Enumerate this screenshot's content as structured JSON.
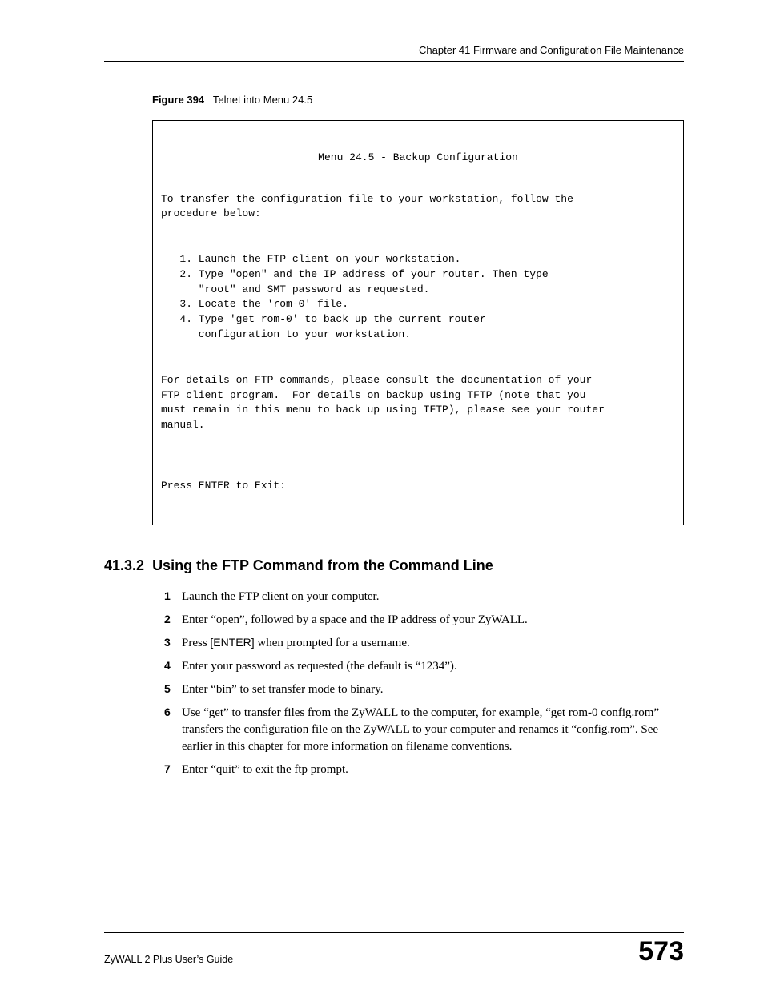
{
  "header": {
    "chapter": "Chapter 41 Firmware and Configuration File Maintenance"
  },
  "figure": {
    "label": "Figure 394",
    "caption": "Telnet into Menu 24.5"
  },
  "telnet": {
    "title": "Menu 24.5 - Backup Configuration",
    "intro": "To transfer the configuration file to your workstation, follow the \nprocedure below:",
    "items": "   1. Launch the FTP client on your workstation.\n   2. Type \"open\" and the IP address of your router. Then type \n      \"root\" and SMT password as requested.\n   3. Locate the 'rom-0' file.\n   4. Type 'get rom-0' to back up the current router \n      configuration to your workstation.",
    "details": "For details on FTP commands, please consult the documentation of your \nFTP client program.  For details on backup using TFTP (note that you \nmust remain in this menu to back up using TFTP), please see your router \nmanual.",
    "press": "Press ENTER to Exit:"
  },
  "section": {
    "number": "41.3.2",
    "title": "Using the FTP Command from the Command Line"
  },
  "steps": {
    "s1": "Launch the FTP client on your computer.",
    "s2": "Enter “open”, followed by a space and the IP address of your ZyWALL.",
    "s3a": "Press ",
    "s3b": "[ENTER]",
    "s3c": " when prompted for a username.",
    "s4": "Enter your password as requested (the default is “1234”).",
    "s5": "Enter “bin” to set transfer mode to binary.",
    "s6": "Use “get” to transfer files from the ZyWALL to the computer, for example, “get rom-0 config.rom” transfers the configuration file on the ZyWALL to your computer and renames it “config.rom”. See earlier in this chapter for more information on filename conventions.",
    "s7": "Enter “quit” to exit the ftp prompt."
  },
  "footer": {
    "guide": "ZyWALL 2 Plus User’s Guide",
    "page": "573"
  }
}
